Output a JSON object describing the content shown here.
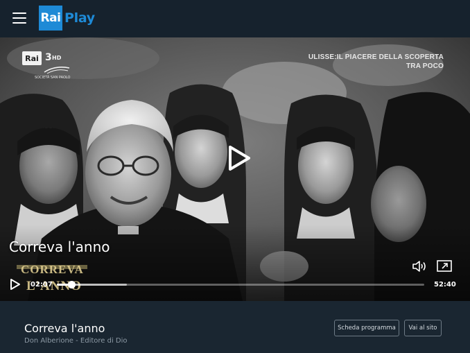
{
  "header": {
    "logo_box": "Rai",
    "logo_text": "Play",
    "menu_icon": "hamburger-menu-icon",
    "brand_color": "#1e8ad6"
  },
  "video": {
    "channel_logo": {
      "rai": "Rai",
      "number": "3",
      "hd": "HD",
      "sponsor": "SOCIETÀ SAN PAOLO"
    },
    "upcoming_line1": "ULISSE:IL PIACERE DELLA SCOPERTA",
    "upcoming_line2": "TRA POCO",
    "title": "Correva l'anno",
    "burned_title_line1": "CORREVA",
    "burned_title_line2": "L'ANNO",
    "center_play_icon": "play-icon",
    "volume_icon": "volume-icon",
    "pip_icon": "picture-in-picture-icon",
    "small_play_icon": "play-icon",
    "time_current": "02:07",
    "time_total": "52:40",
    "progress_fraction": 0.04,
    "buffer_fraction": 0.19
  },
  "info": {
    "title": "Correva l'anno",
    "subtitle": "Don Alberione - Editore di Dio",
    "btn_scheda": "Scheda programma",
    "btn_sito": "Vai al sito"
  }
}
